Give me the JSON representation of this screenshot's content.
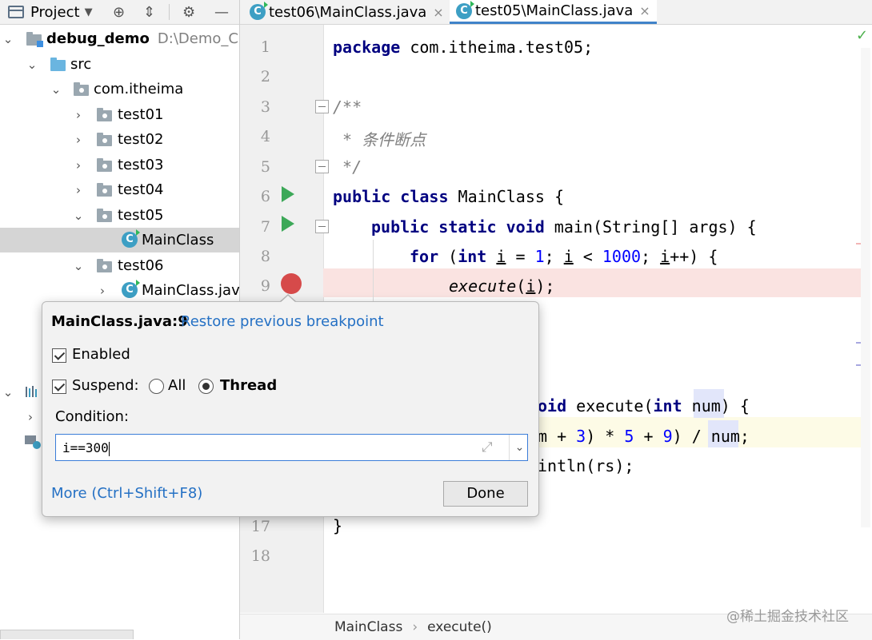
{
  "project_panel": {
    "title": "Project",
    "toolbar_icons": [
      "chevron-down-icon",
      "crosshair-icon",
      "collapse-icon",
      "gear-icon",
      "minimize-icon"
    ],
    "tree": [
      {
        "label": "debug_demo",
        "extra": "D:\\Demo_Coo",
        "bold": true
      },
      {
        "label": "src"
      },
      {
        "label": "com.itheima"
      },
      {
        "label": "test01"
      },
      {
        "label": "test02"
      },
      {
        "label": "test03"
      },
      {
        "label": "test04"
      },
      {
        "label": "test05"
      },
      {
        "label": "MainClass"
      },
      {
        "label": "test06"
      },
      {
        "label": "MainClass.java"
      }
    ]
  },
  "tabs": [
    {
      "label": "test06\\MainClass.java",
      "active": false
    },
    {
      "label": "test05\\MainClass.java",
      "active": true
    }
  ],
  "editor": {
    "line_numbers": [
      "1",
      "2",
      "3",
      "4",
      "5",
      "6",
      "7",
      "8",
      "9",
      "17",
      "18"
    ],
    "lines": {
      "l1_kw": "package",
      "l1_rest": " com.itheima.test05;",
      "l3": "/**",
      "l4": " * 条件断点",
      "l5": " */",
      "l6_kw1": "public",
      "l6_kw2": "class",
      "l6_rest": " MainClass {",
      "l7_kw1": "public",
      "l7_kw2": "static",
      "l7_kw3": "void",
      "l7_rest": " main(String[] args) {",
      "l8_kw1": "for",
      "l8_p1": " (",
      "l8_kw2": "int",
      "l8_v1": "i",
      "l8_p2": " = ",
      "l8_n1": "1",
      "l8_p3": "; ",
      "l8_v2": "i",
      "l8_p4": " < ",
      "l8_n2": "1000",
      "l8_p5": "; ",
      "l8_v3": "i",
      "l8_p6": "++) {",
      "l9_fn": "execute",
      "l9_p1": "(",
      "l9_v": "i",
      "l9_p2": ");",
      "l13_kw": "oid",
      "l13_mid": " execute(",
      "l13_kw2": "int",
      "l13_sp": " ",
      "l13_param": "num",
      "l13_end": ") {",
      "l14_a": "m + ",
      "l14_n1": "3",
      "l14_b": ") * ",
      "l14_n2": "5",
      "l14_c": " + ",
      "l14_n3": "9",
      "l14_d": ") / ",
      "l14_param": "num",
      "l14_e": ";",
      "l15": "intln(rs);",
      "l17": "}"
    }
  },
  "breadcrumb": {
    "item1": "MainClass",
    "separator": "›",
    "item2": "execute()"
  },
  "watermark": "@稀土掘金技术社区",
  "popup": {
    "title": "MainClass.java:9",
    "restore_link": "Restore previous breakpoint",
    "enabled_label": "Enabled",
    "enabled_checked": true,
    "suspend_label": "Suspend:",
    "suspend_checked": true,
    "radio_all": "All",
    "radio_thread": "Thread",
    "selected_radio": "Thread",
    "condition_label": "Condition:",
    "condition_value": "i==300",
    "more_link": "More (Ctrl+Shift+F8)",
    "done_label": "Done"
  },
  "colors": {
    "keyword": "#000080",
    "number": "#0000ff",
    "comment": "#808080",
    "breakpoint": "#d64a4a",
    "run": "#3ca858",
    "link": "#2470c4"
  }
}
